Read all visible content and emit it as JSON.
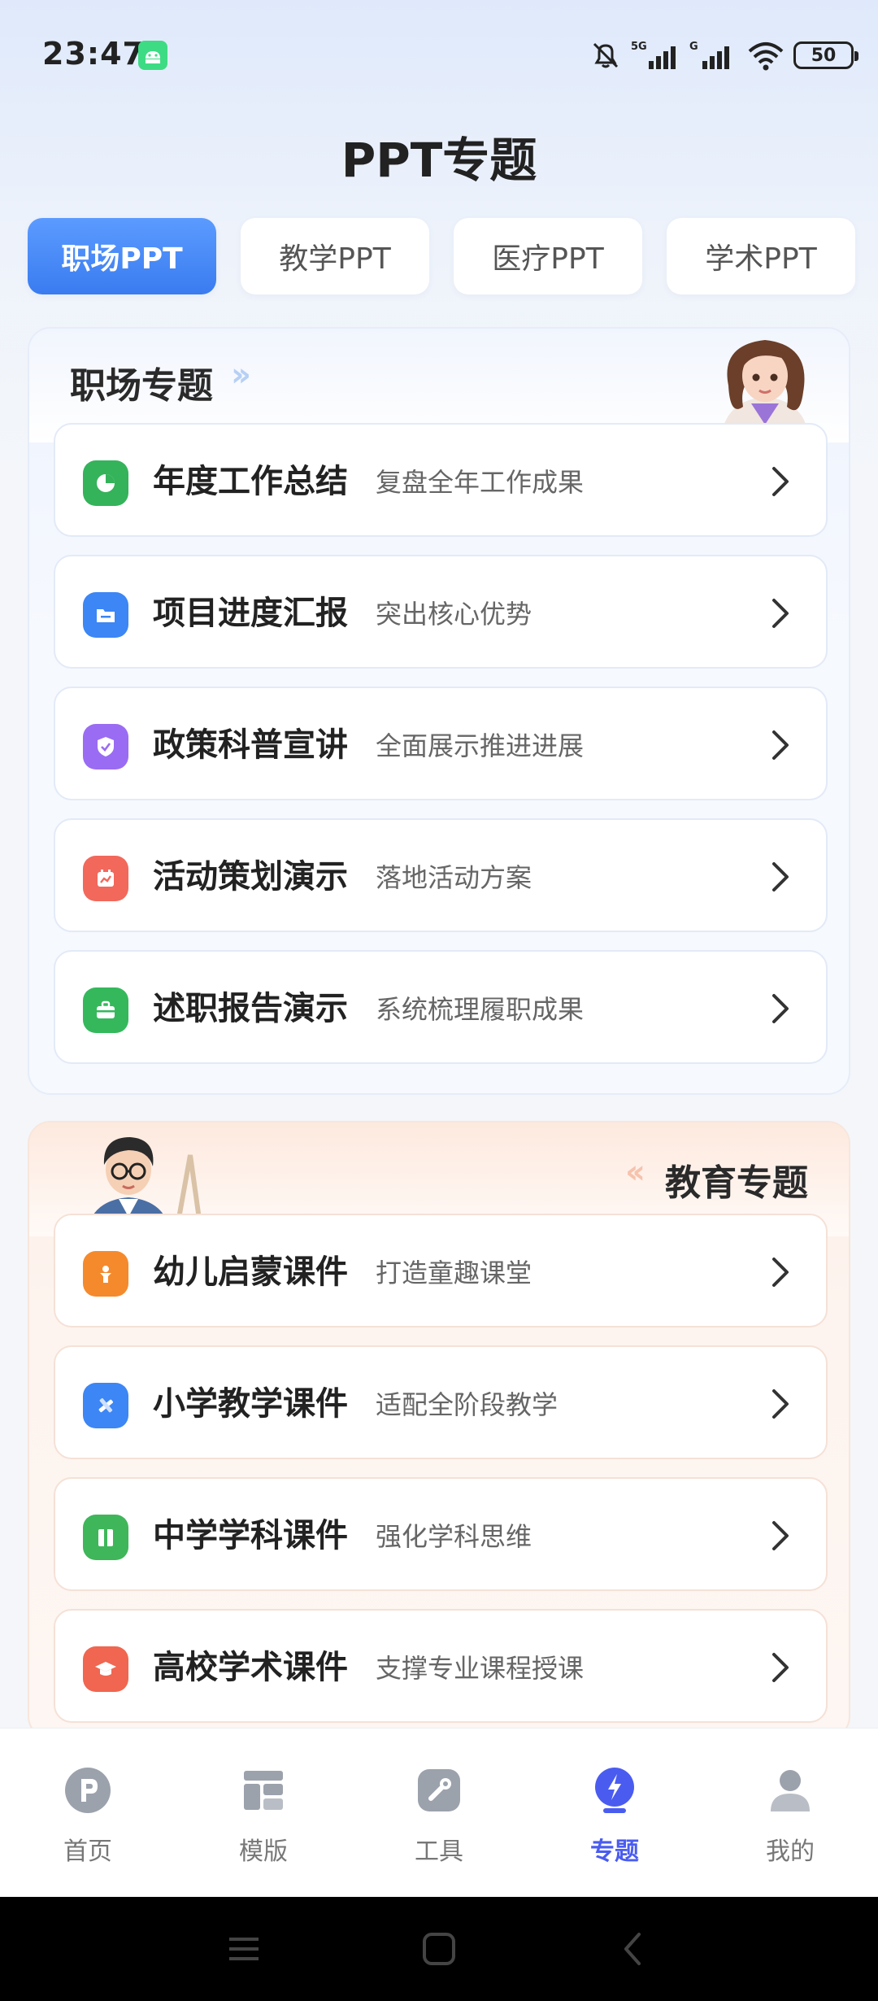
{
  "status": {
    "time": "23:47",
    "battery": "50",
    "network": "5G"
  },
  "title": "PPT专题",
  "tabs": [
    {
      "label": "职场PPT",
      "active": true
    },
    {
      "label": "教学PPT",
      "active": false
    },
    {
      "label": "医疗PPT",
      "active": false
    },
    {
      "label": "学术PPT",
      "active": false
    }
  ],
  "sections": {
    "work": {
      "title": "职场专题",
      "items": [
        {
          "name": "年度工作总结",
          "desc": "复盘全年工作成果",
          "icon": "pie-chart-icon",
          "color": "#34b35a"
        },
        {
          "name": "项目进度汇报",
          "desc": "突出核心优势",
          "icon": "folder-icon",
          "color": "#3c86f5"
        },
        {
          "name": "政策科普宣讲",
          "desc": "全面展示推进进展",
          "icon": "shield-icon",
          "color": "#9a6cf3"
        },
        {
          "name": "活动策划演示",
          "desc": "落地活动方案",
          "icon": "calendar-icon",
          "color": "#f2685b"
        },
        {
          "name": "述职报告演示",
          "desc": "系统梳理履职成果",
          "icon": "briefcase-icon",
          "color": "#35b85c"
        }
      ]
    },
    "edu": {
      "title": "教育专题",
      "items": [
        {
          "name": "幼儿启蒙课件",
          "desc": "打造童趣课堂",
          "icon": "child-icon",
          "color": "#f58a2c"
        },
        {
          "name": "小学教学课件",
          "desc": "适配全阶段教学",
          "icon": "ruler-pencil-icon",
          "color": "#3c86f5"
        },
        {
          "name": "中学学科课件",
          "desc": "强化学科思维",
          "icon": "book-icon",
          "color": "#3fb65a"
        },
        {
          "name": "高校学术课件",
          "desc": "支撑专业课程授课",
          "icon": "graduation-cap-icon",
          "color": "#f06650"
        }
      ]
    }
  },
  "nav": [
    {
      "label": "首页",
      "icon": "home-p-icon",
      "active": false
    },
    {
      "label": "模版",
      "icon": "template-icon",
      "active": false
    },
    {
      "label": "工具",
      "icon": "tools-icon",
      "active": false
    },
    {
      "label": "专题",
      "icon": "topic-lightning-icon",
      "active": true
    },
    {
      "label": "我的",
      "icon": "profile-icon",
      "active": false
    }
  ],
  "colors": {
    "accent": "#3a7cf0",
    "nav_active": "#4a5cf0",
    "nav_inactive": "#9aa0aa"
  }
}
